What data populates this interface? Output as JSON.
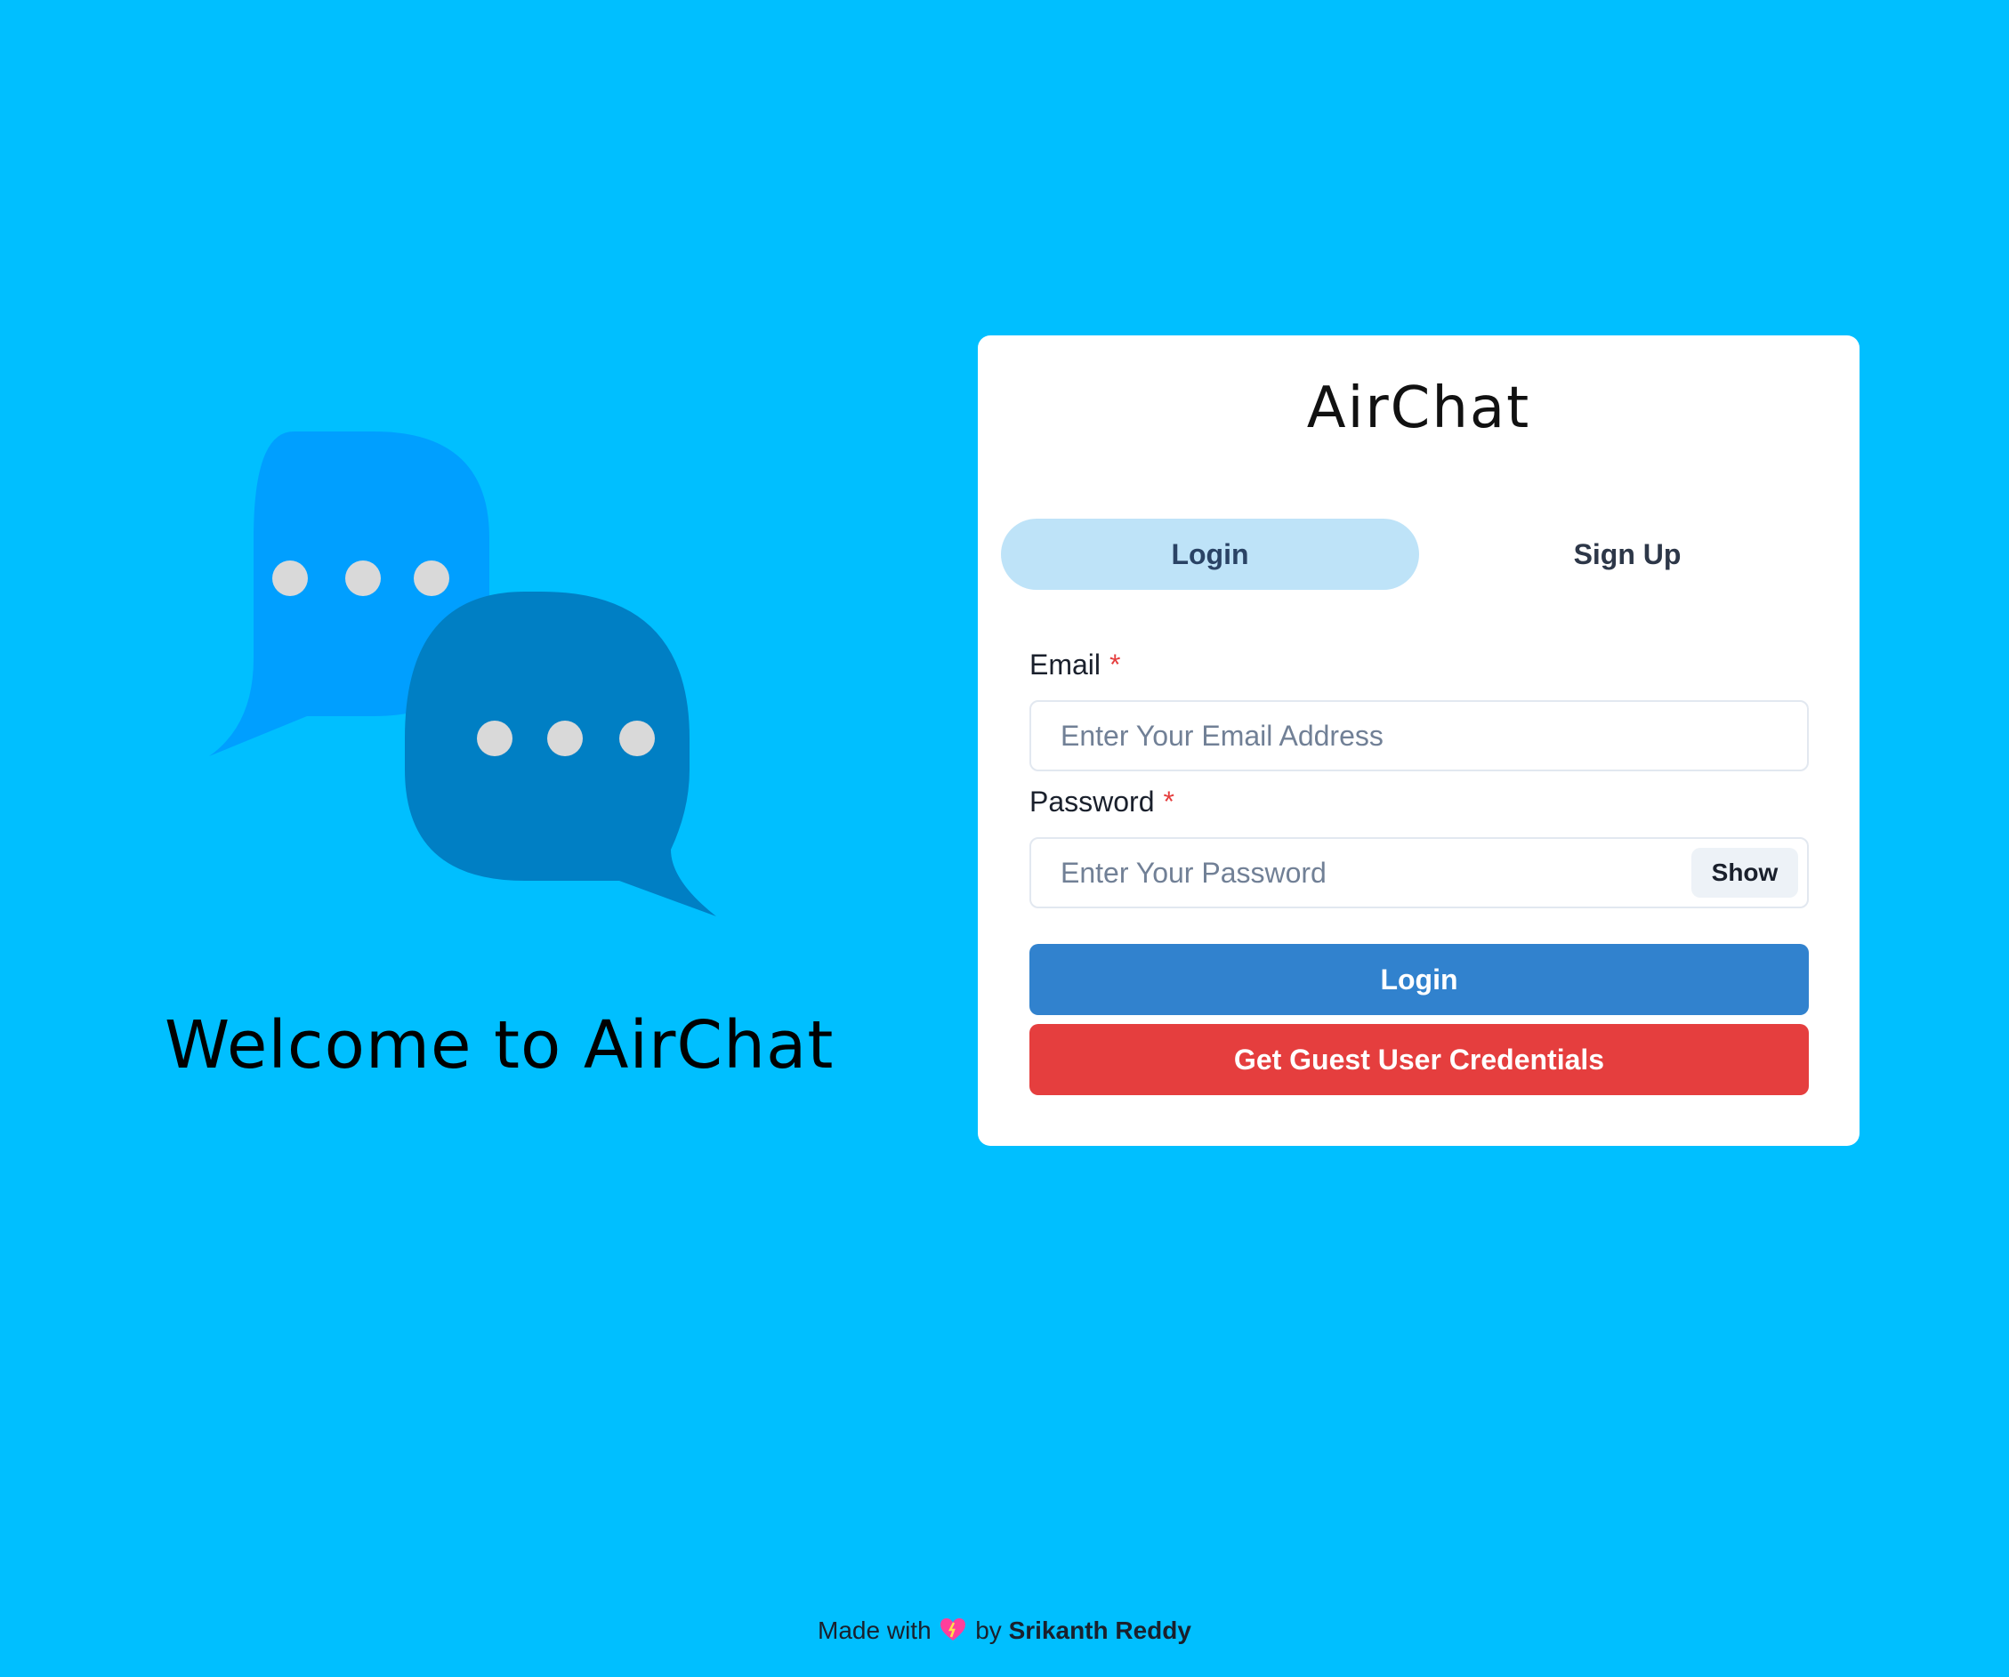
{
  "hero": {
    "title": "Welcome to AirChat",
    "colors": {
      "back_bubble": "#009fff",
      "front_bubble": "#007fc4",
      "dots": "#d9d9d9"
    }
  },
  "card": {
    "app_title": "AirChat",
    "tabs": [
      {
        "label": "Login",
        "active": true
      },
      {
        "label": "Sign Up",
        "active": false
      }
    ],
    "email": {
      "label": "Email",
      "required_mark": "*",
      "placeholder": "Enter Your Email Address",
      "value": ""
    },
    "password": {
      "label": "Password",
      "required_mark": "*",
      "placeholder": "Enter Your Password",
      "value": "",
      "toggle_label": "Show"
    },
    "login_button": "Login",
    "guest_button": "Get Guest User Credentials"
  },
  "footer": {
    "prefix": "Made with",
    "icon": "heart-icon",
    "by": "by",
    "author": "Srikanth Reddy"
  },
  "colors": {
    "background": "#00bfff",
    "card": "#ffffff",
    "tab_active": "#bee3f8",
    "primary": "#3182ce",
    "danger": "#e53e3e",
    "required": "#e53e3e"
  }
}
